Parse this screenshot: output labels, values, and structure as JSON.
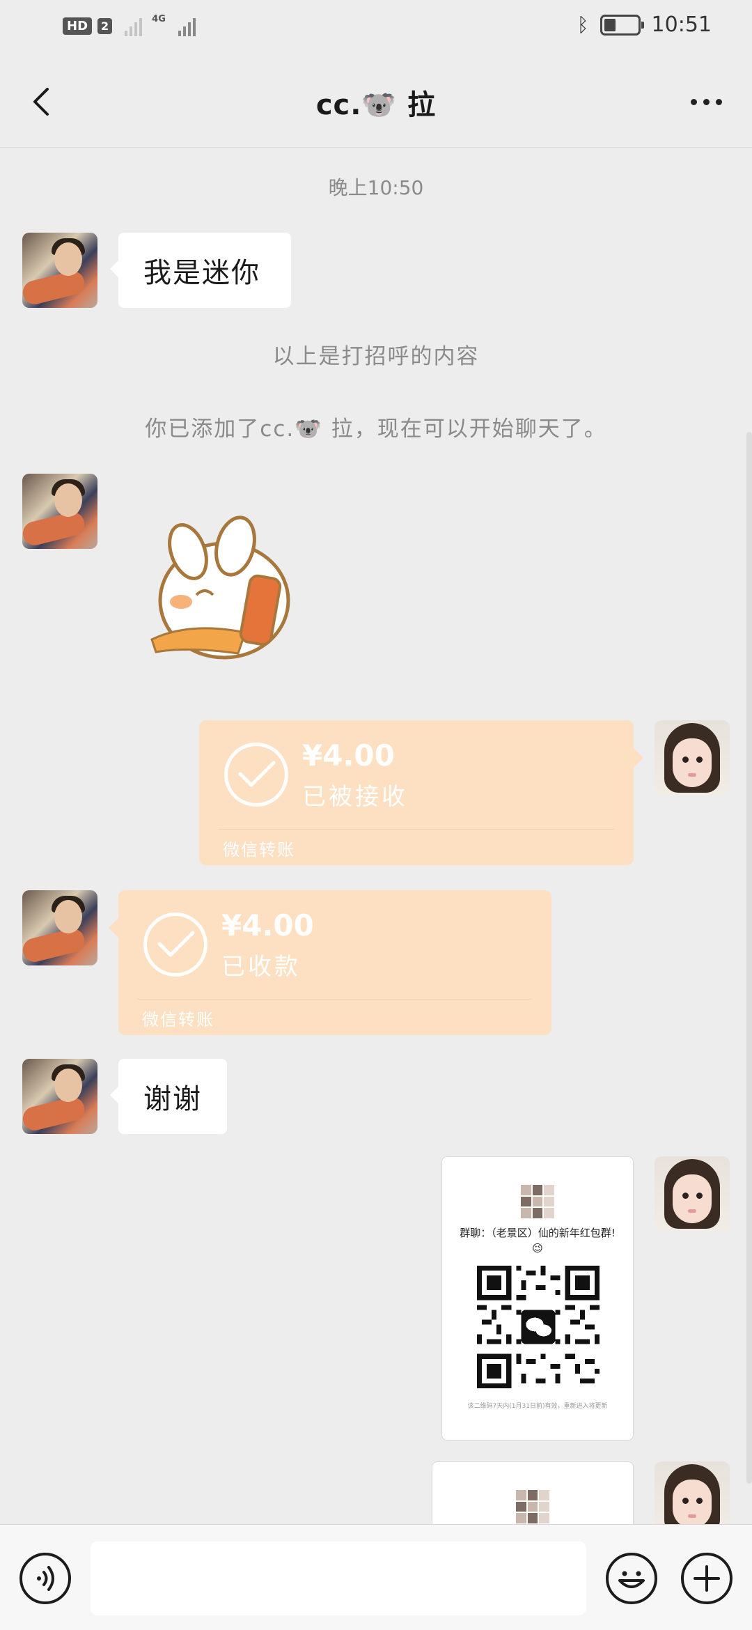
{
  "status_bar": {
    "hd": "HD",
    "sim": "2",
    "network": "4G",
    "time": "10:51"
  },
  "header": {
    "title": "cc.🐨 拉",
    "back_icon": "chevron-left-icon",
    "more_icon": "more-dots-icon"
  },
  "messages": {
    "time_label": "晚上10:50",
    "friend_greeting": "我是迷你",
    "greeting_note": "以上是打招呼的内容",
    "added_note": "你已添加了cc.🐨 拉，现在可以开始聊天了。",
    "sticker": "bunny-sticker",
    "transfer_sent": {
      "amount": "¥4.00",
      "status": "已被接收",
      "footer": "微信转账"
    },
    "transfer_received": {
      "amount": "¥4.00",
      "status": "已收款",
      "footer": "微信转账"
    },
    "thanks": "谢谢",
    "qr_card": {
      "title": "群聊：（老景区）仙的新年红包群!😉",
      "note": "该二维码7天内(1月31日前)有效，重新进入将更新"
    }
  },
  "input_bar": {
    "voice_icon": "voice-icon",
    "emoji_icon": "emoji-icon",
    "plus_icon": "plus-icon",
    "value": ""
  },
  "colors": {
    "background": "#ededed",
    "transfer": "#fde0c1",
    "bubble": "#ffffff"
  }
}
